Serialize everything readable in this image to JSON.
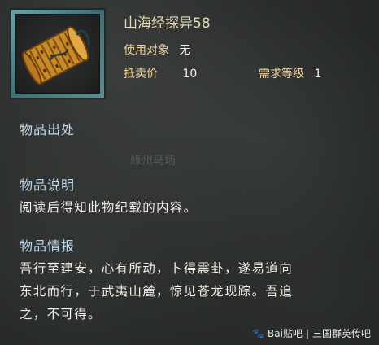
{
  "item": {
    "name": "山海经探异58",
    "target_label": "使用对象",
    "target_value": "无",
    "price_label": "抵卖价",
    "price_value": "10",
    "level_label": "需求等级",
    "level_value": "1",
    "icon": "scroll-icon"
  },
  "sections": {
    "source_title": "物品出处",
    "source_faint": "綠州马场",
    "desc_title": "物品说明",
    "desc_text": "阅读后得知此物纪载的内容。",
    "info_title": "物品情报",
    "info_lines": [
      "吾行至建安，心有所动，卜得震卦，遂易道向",
      "东北而行，于武夷山麓，惊见苍龙现踪。吾追",
      "之，不可得。"
    ]
  },
  "footer": {
    "watermark": "Bai贴吧",
    "forum": "三国群英传吧"
  },
  "colors": {
    "frame": "#5d9094",
    "label": "#f3d59a",
    "heading": "#bfd8ea"
  }
}
